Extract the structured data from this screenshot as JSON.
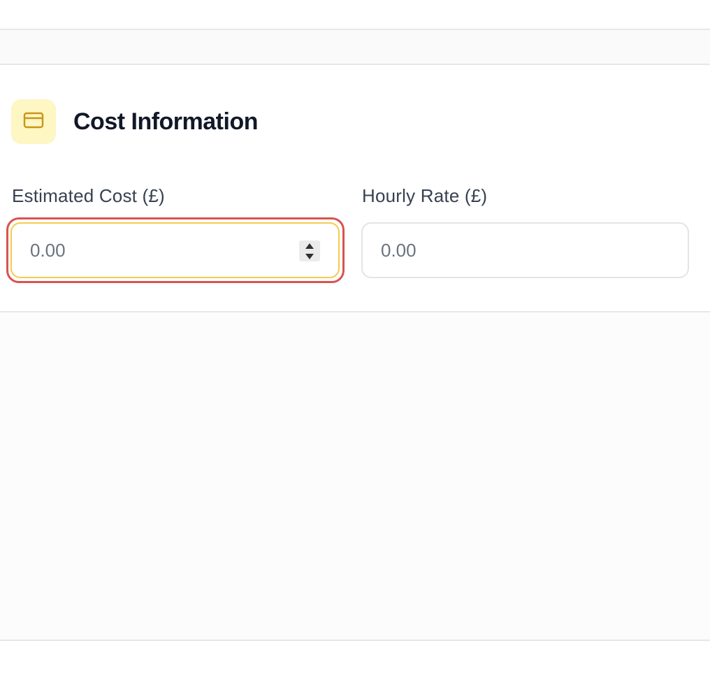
{
  "section": {
    "title": "Cost Information",
    "icon": "credit-card-icon",
    "icon_bg_color": "#fef6c3",
    "icon_color": "#c9951a"
  },
  "fields": {
    "estimated_cost": {
      "label": "Estimated Cost (£)",
      "placeholder": "0.00",
      "focused": true,
      "focus_ring_color": "#d9534f",
      "border_color": "#f2cc4d"
    },
    "hourly_rate": {
      "label": "Hourly Rate (£)",
      "placeholder": "0.00",
      "border_color": "#e3e4e8"
    }
  },
  "spinner": {
    "up_icon": "caret-up-icon",
    "down_icon": "caret-down-icon"
  }
}
